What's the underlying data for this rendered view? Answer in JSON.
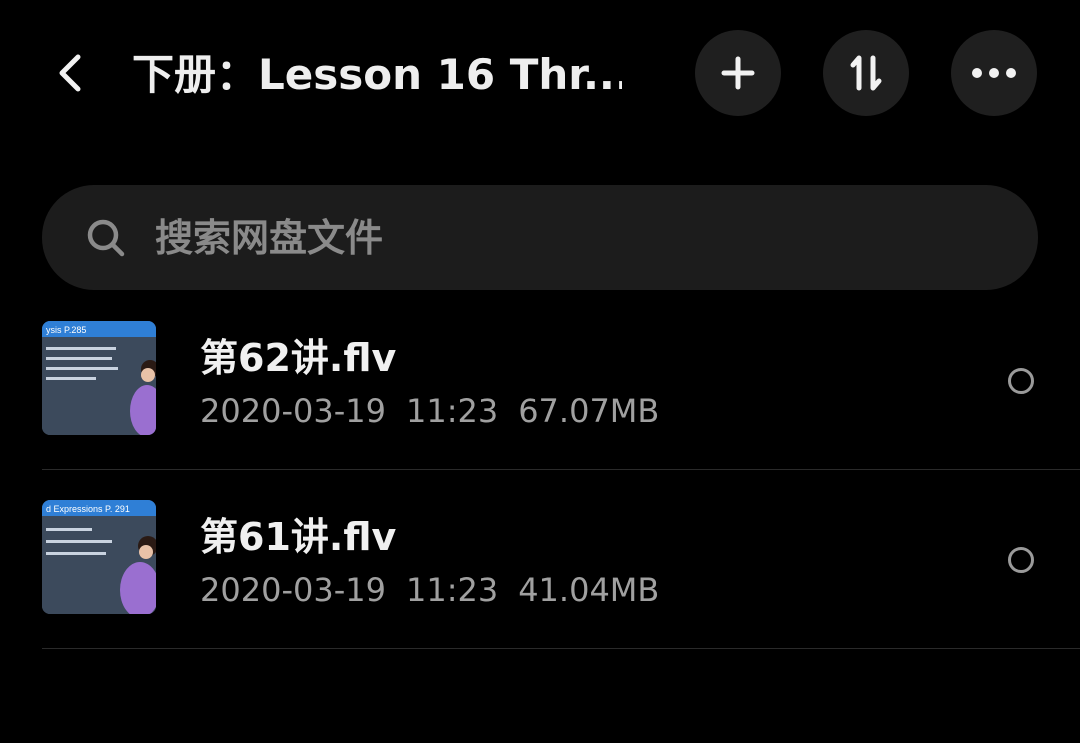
{
  "header": {
    "title": "下册：Lesson 16 Thr...",
    "back_icon": "chevron-left-icon",
    "add_icon": "plus-icon",
    "sort_icon": "sort-icon",
    "more_icon": "more-horizontal-icon"
  },
  "search": {
    "placeholder": "搜索网盘文件",
    "icon": "search-icon"
  },
  "files": [
    {
      "name": "第62讲.flv",
      "date": "2020-03-19",
      "time": "11:23",
      "size": "67.07MB",
      "thumb_caption": "ysis P.285",
      "selected": false
    },
    {
      "name": "第61讲.flv",
      "date": "2020-03-19",
      "time": "11:23",
      "size": "41.04MB",
      "thumb_caption": "d Expressions P. 291",
      "selected": false
    }
  ],
  "colors": {
    "background": "#000000",
    "button_bg": "#1f1f1f",
    "search_bg": "#1c1c1c",
    "thumb_header": "#2f7fd6",
    "thumb_body": "#3c4a5c"
  }
}
